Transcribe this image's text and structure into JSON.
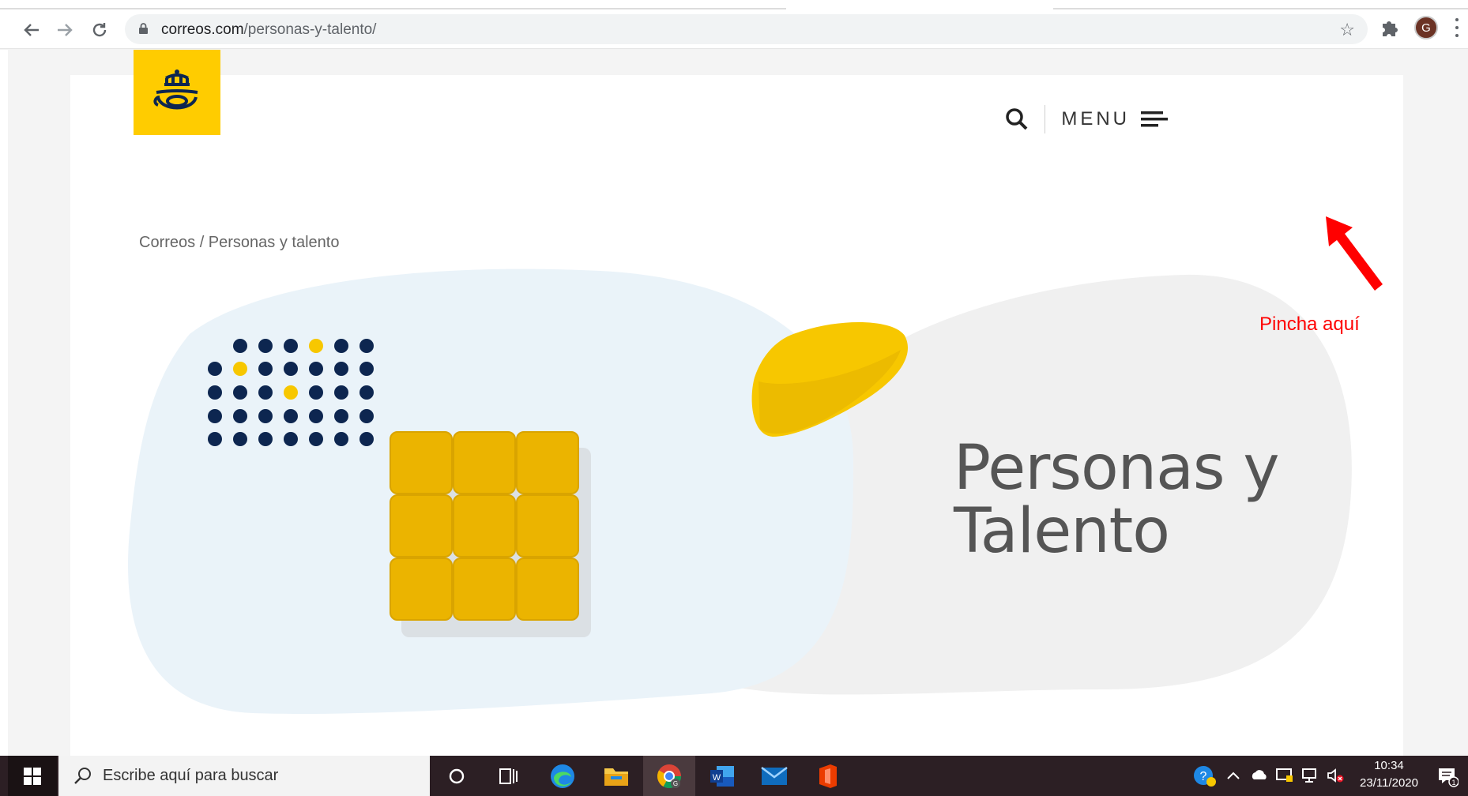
{
  "browser": {
    "url_host": "correos.com",
    "url_path": "/personas-y-talento/",
    "avatar_letter": "G"
  },
  "page": {
    "breadcrumb": "Correos / Personas y talento",
    "menu_label": "MENU",
    "hero_title_line1": "Personas y",
    "hero_title_line2": "Talento",
    "brand_yellow": "#ffcc00",
    "dot_navy": "#0d2650",
    "cube_yellow": "#ebb400"
  },
  "annotation": {
    "text": "Pincha aquí",
    "color": "#ff0000"
  },
  "taskbar": {
    "search_placeholder": "Escribe aquí para buscar",
    "time": "10:34",
    "date": "23/11/2020"
  }
}
